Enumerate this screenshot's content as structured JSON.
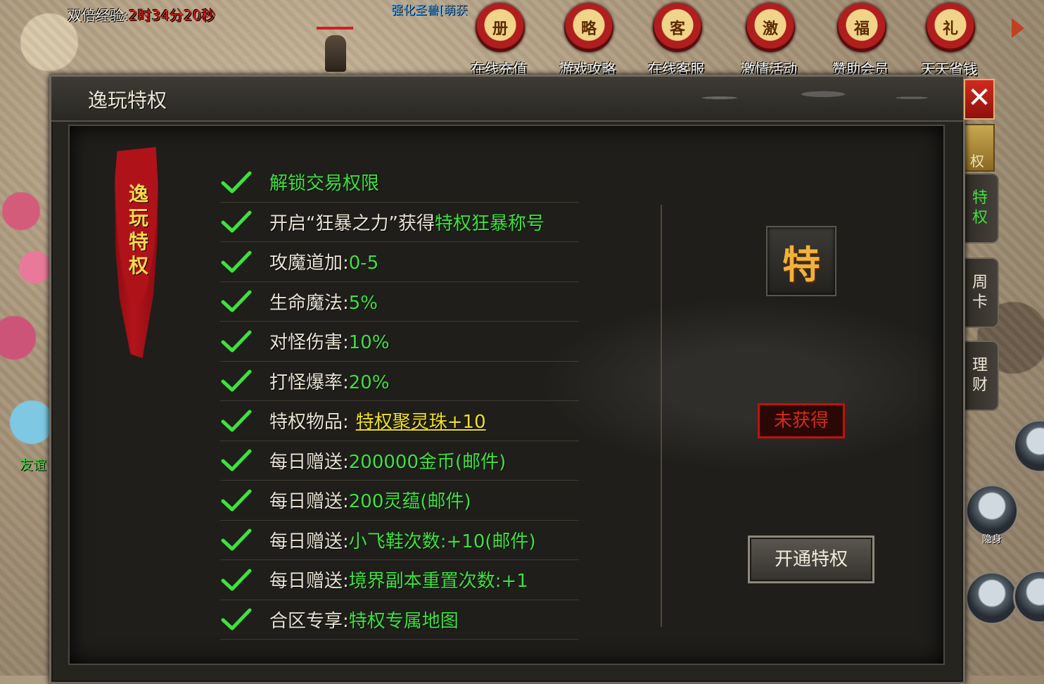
{
  "hud": {
    "double_exp_label": "双倍经验:",
    "double_exp_timer": "2时34分20秒",
    "npc_name": "强化圣兽[萌获",
    "friend_label": "友谊"
  },
  "top_menu": [
    {
      "label": "在线充值",
      "glyph": "册"
    },
    {
      "label": "游戏攻略",
      "glyph": "略"
    },
    {
      "label": "在线客服",
      "glyph": "客"
    },
    {
      "label": "激情活动",
      "glyph": "激"
    },
    {
      "label": "赞助会员",
      "glyph": "福"
    },
    {
      "label": "天天省钱",
      "glyph": "礼"
    }
  ],
  "side_tabs": {
    "top": "权",
    "privilege": [
      "特",
      "权"
    ],
    "weekly_card": [
      "周",
      "卡"
    ],
    "finance": [
      "理",
      "财"
    ]
  },
  "skills": {
    "stealth_label": "隐身"
  },
  "dialog": {
    "title": "逸玩特权",
    "close_glyph": "✕",
    "banner": [
      "逸",
      "玩",
      "特",
      "权"
    ],
    "perks": [
      {
        "value": "解锁交易权限"
      },
      {
        "label": "开启“狂暴之力”获得",
        "value": "特权狂暴称号"
      },
      {
        "label": "攻魔道加:",
        "value": "0-5"
      },
      {
        "label": "生命魔法:",
        "value": "5%"
      },
      {
        "label": "对怪伤害:",
        "value": "10%"
      },
      {
        "label": "打怪爆率:",
        "value": "20%"
      },
      {
        "label": "特权物品:",
        "link": "特权聚灵珠+10"
      },
      {
        "label": "每日赠送:",
        "value": "200000金币(邮件)"
      },
      {
        "label": "每日赠送:",
        "value": "200灵蕴(邮件)"
      },
      {
        "label": "每日赠送:",
        "value": "小飞鞋次数:+10(邮件)"
      },
      {
        "label": "每日赠送:",
        "value": "境界副本重置次数:+1"
      },
      {
        "label": "合区专享:",
        "value": "特权专属地图"
      }
    ],
    "privilege_glyph": "特",
    "status": "未获得",
    "activate_label": "开通特权"
  },
  "colors": {
    "value_green": "#3ee23e",
    "link_yellow": "#f0e020",
    "status_red": "#d42a1a",
    "banner_gold": "#ffd84a",
    "close_red": "#d22a1a"
  }
}
